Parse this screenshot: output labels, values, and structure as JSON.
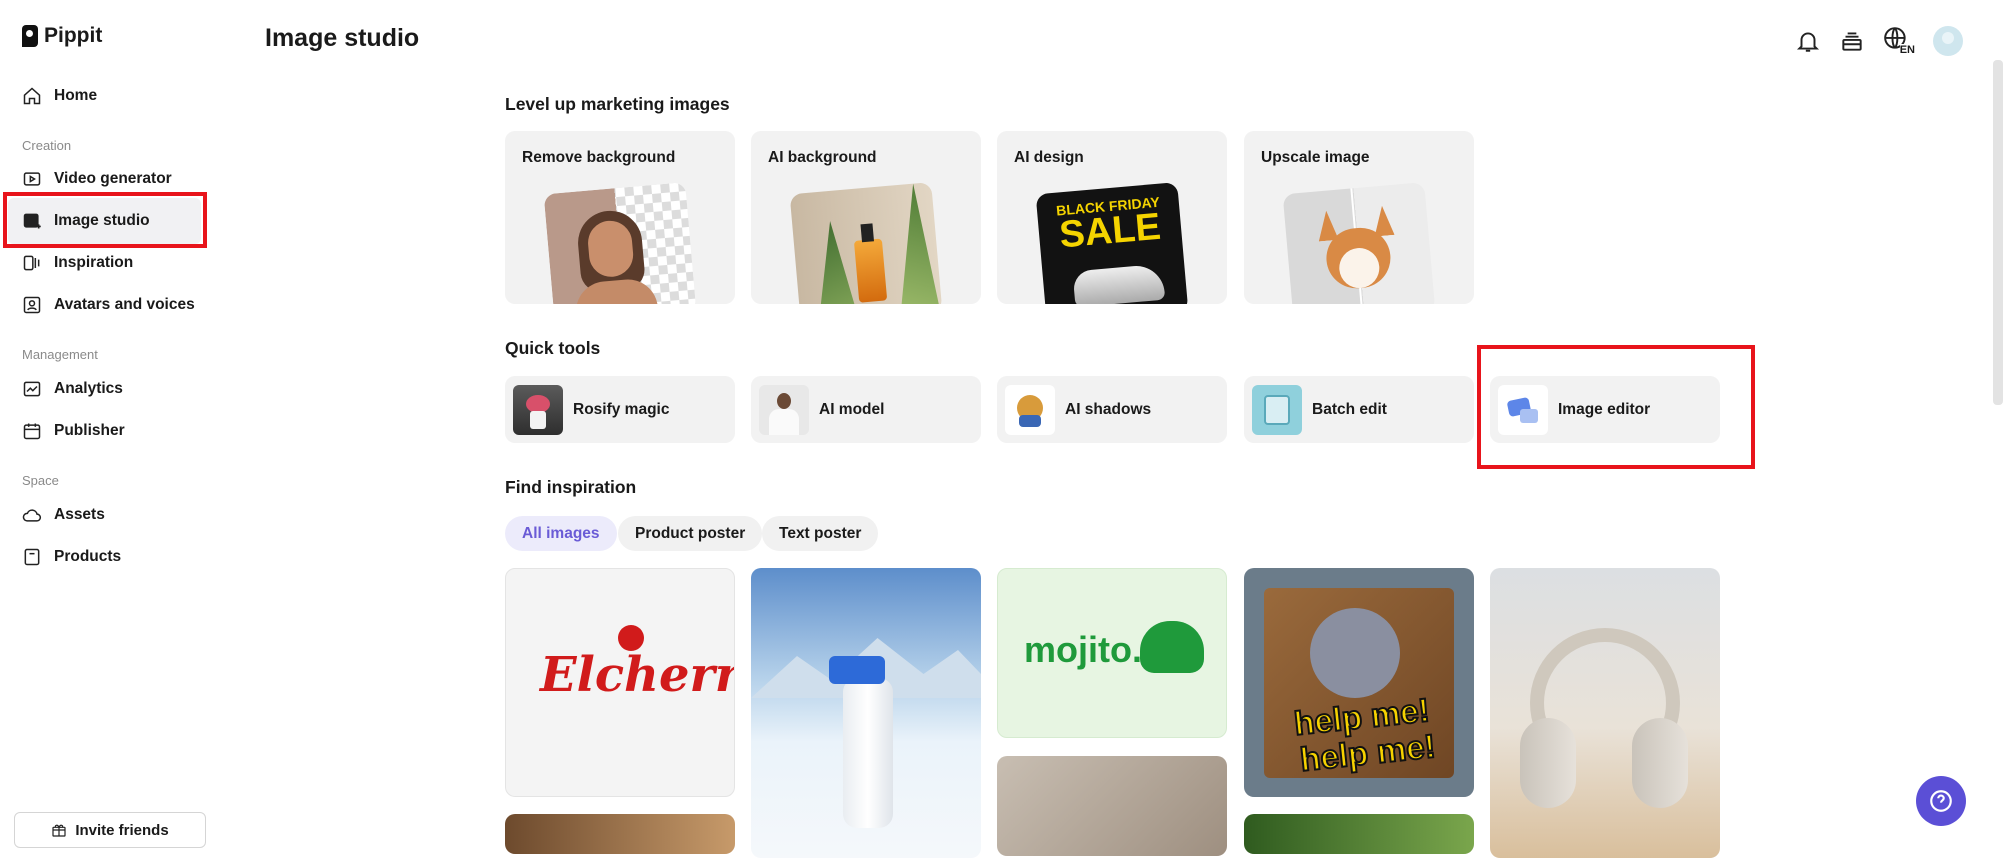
{
  "app": {
    "name": "Pippit"
  },
  "sidebar": {
    "home": "Home",
    "creation_label": "Creation",
    "items_creation": [
      "Video generator",
      "Image studio",
      "Inspiration",
      "Avatars and voices"
    ],
    "management_label": "Management",
    "items_management": [
      "Analytics",
      "Publisher"
    ],
    "space_label": "Space",
    "items_space": [
      "Assets",
      "Products"
    ],
    "invite": "Invite friends"
  },
  "header": {
    "title": "Image studio",
    "lang": "EN"
  },
  "marketing": {
    "heading": "Level up marketing images",
    "cards": [
      "Remove background",
      "AI background",
      "AI design",
      "Upscale image"
    ],
    "ai_design_text": {
      "line1": "BLACK FRIDAY",
      "line2": "SALE"
    }
  },
  "quick_tools": {
    "heading": "Quick tools",
    "items": [
      "Rosify magic",
      "AI model",
      "AI shadows",
      "Batch edit",
      "Image editor"
    ]
  },
  "inspiration": {
    "heading": "Find inspiration",
    "filters": [
      "All images",
      "Product poster",
      "Text poster"
    ],
    "selected_filter": "All images",
    "tile_texts": {
      "elcherry": "Elcherry",
      "mojito": "mojito.",
      "help1": "help me!",
      "help2": "help me!"
    }
  },
  "colors": {
    "accent": "#6a5bd6",
    "highlight": "#e8141b",
    "help_button": "#5b4fd6"
  }
}
